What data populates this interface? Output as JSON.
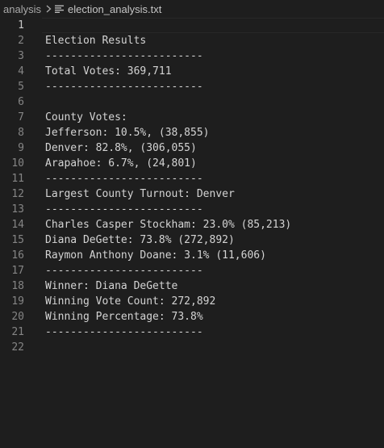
{
  "breadcrumb": {
    "folder": "analysis",
    "file": "election_analysis.txt"
  },
  "editor": {
    "lines": [
      {
        "n": "1",
        "text": ""
      },
      {
        "n": "2",
        "text": "Election Results"
      },
      {
        "n": "3",
        "text": "-------------------------"
      },
      {
        "n": "4",
        "text": "Total Votes: 369,711"
      },
      {
        "n": "5",
        "text": "-------------------------"
      },
      {
        "n": "6",
        "text": ""
      },
      {
        "n": "7",
        "text": "County Votes:"
      },
      {
        "n": "8",
        "text": "Jefferson: 10.5%, (38,855)"
      },
      {
        "n": "9",
        "text": "Denver: 82.8%, (306,055)"
      },
      {
        "n": "10",
        "text": "Arapahoe: 6.7%, (24,801)"
      },
      {
        "n": "11",
        "text": "-------------------------"
      },
      {
        "n": "12",
        "text": "Largest County Turnout: Denver"
      },
      {
        "n": "13",
        "text": "-------------------------"
      },
      {
        "n": "14",
        "text": "Charles Casper Stockham: 23.0% (85,213)"
      },
      {
        "n": "15",
        "text": "Diana DeGette: 73.8% (272,892)"
      },
      {
        "n": "16",
        "text": "Raymon Anthony Doane: 3.1% (11,606)"
      },
      {
        "n": "17",
        "text": "-------------------------"
      },
      {
        "n": "18",
        "text": "Winner: Diana DeGette"
      },
      {
        "n": "19",
        "text": "Winning Vote Count: 272,892"
      },
      {
        "n": "20",
        "text": "Winning Percentage: 73.8%"
      },
      {
        "n": "21",
        "text": "-------------------------"
      },
      {
        "n": "22",
        "text": ""
      }
    ]
  },
  "colors": {
    "background": "#1e1e1e",
    "text": "#d4d4d4",
    "line_number": "#858585"
  }
}
